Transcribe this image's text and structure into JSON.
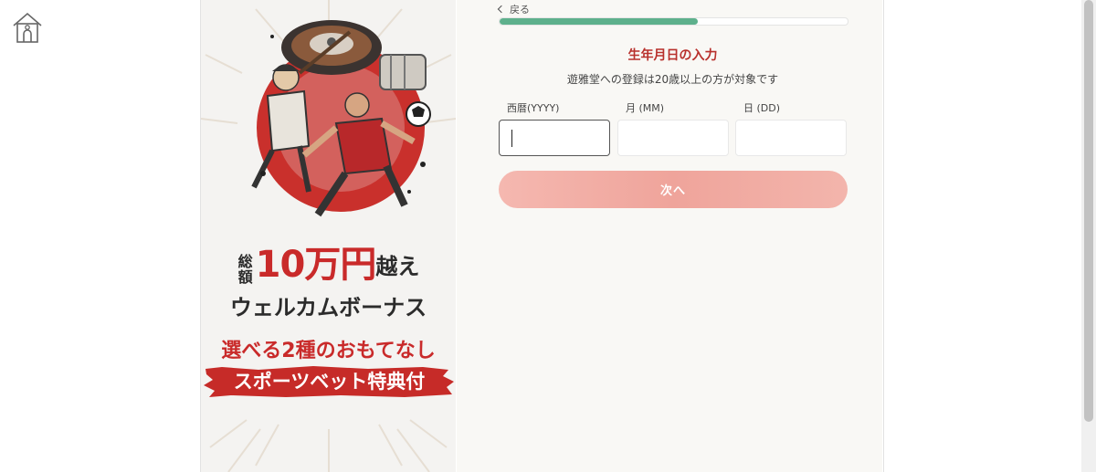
{
  "header": {
    "home_icon": "house-icon"
  },
  "promo": {
    "line1_small_a": "総",
    "line1_small_b": "額",
    "line1_big": "10万円",
    "line1_suffix": "越え",
    "line2": "ウェルカムボーナス",
    "line3": "選べる2種のおもてなし",
    "banner": "スポーツベット特典付",
    "accent_color": "#c92a2a"
  },
  "form": {
    "back_label": "戻る",
    "progress_fraction": 0.57,
    "progress_color": "#5eb08c",
    "title": "生年月日の入力",
    "subtitle": "遊雅堂への登録は20歳以上の方が対象です",
    "title_color": "#b8302c",
    "fields": [
      {
        "label": "西暦(YYYY)",
        "value": "",
        "active": true
      },
      {
        "label": "月 (MM)",
        "value": "",
        "active": false
      },
      {
        "label": "日 (DD)",
        "value": "",
        "active": false
      }
    ],
    "next_label": "次へ"
  }
}
